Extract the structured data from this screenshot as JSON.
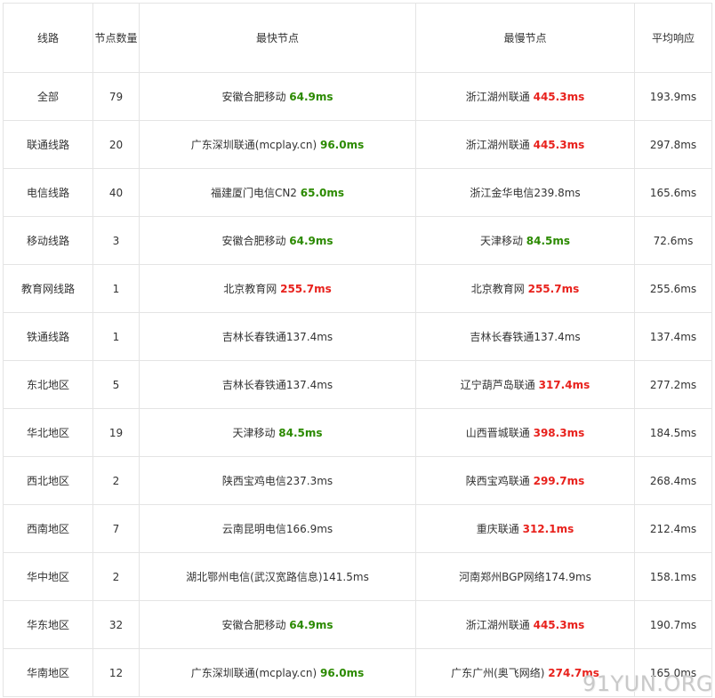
{
  "headers": [
    "线路",
    "节点数量",
    "最快节点",
    "最慢节点",
    "平均响应"
  ],
  "colors": {
    "fast": "#2b8a00",
    "slow": "#e8211c",
    "text": "#333333",
    "border": "#e4e4e4"
  },
  "rows": [
    {
      "line": "全部",
      "count": "79",
      "fast_name": "安徽合肥移动",
      "fast_val": "64.9ms",
      "fast_tone": "fast",
      "slow_name": "浙江湖州联通",
      "slow_val": "445.3ms",
      "slow_tone": "slow",
      "avg": "193.9ms"
    },
    {
      "line": "联通线路",
      "count": "20",
      "fast_name": "广东深圳联通(mcplay.cn)",
      "fast_val": "96.0ms",
      "fast_tone": "fast",
      "slow_name": "浙江湖州联通",
      "slow_val": "445.3ms",
      "slow_tone": "slow",
      "avg": "297.8ms"
    },
    {
      "line": "电信线路",
      "count": "40",
      "fast_name": "福建厦门电信CN2",
      "fast_val": "65.0ms",
      "fast_tone": "fast",
      "slow_name": "浙江金华电信",
      "slow_val": "239.8ms",
      "slow_tone": "plain",
      "avg": "165.6ms"
    },
    {
      "line": "移动线路",
      "count": "3",
      "fast_name": "安徽合肥移动",
      "fast_val": "64.9ms",
      "fast_tone": "fast",
      "slow_name": "天津移动",
      "slow_val": "84.5ms",
      "slow_tone": "fast",
      "avg": "72.6ms"
    },
    {
      "line": "教育网线路",
      "count": "1",
      "fast_name": "北京教育网",
      "fast_val": "255.7ms",
      "fast_tone": "slow",
      "slow_name": "北京教育网",
      "slow_val": "255.7ms",
      "slow_tone": "slow",
      "avg": "255.6ms"
    },
    {
      "line": "铁通线路",
      "count": "1",
      "fast_name": "吉林长春铁通",
      "fast_val": "137.4ms",
      "fast_tone": "plain",
      "slow_name": "吉林长春铁通",
      "slow_val": "137.4ms",
      "slow_tone": "plain",
      "avg": "137.4ms"
    },
    {
      "line": "东北地区",
      "count": "5",
      "fast_name": "吉林长春铁通",
      "fast_val": "137.4ms",
      "fast_tone": "plain",
      "slow_name": "辽宁葫芦岛联通",
      "slow_val": "317.4ms",
      "slow_tone": "slow",
      "avg": "277.2ms"
    },
    {
      "line": "华北地区",
      "count": "19",
      "fast_name": "天津移动",
      "fast_val": "84.5ms",
      "fast_tone": "fast",
      "slow_name": "山西晋城联通",
      "slow_val": "398.3ms",
      "slow_tone": "slow",
      "avg": "184.5ms"
    },
    {
      "line": "西北地区",
      "count": "2",
      "fast_name": "陕西宝鸡电信",
      "fast_val": "237.3ms",
      "fast_tone": "plain",
      "slow_name": "陕西宝鸡联通",
      "slow_val": "299.7ms",
      "slow_tone": "slow",
      "avg": "268.4ms"
    },
    {
      "line": "西南地区",
      "count": "7",
      "fast_name": "云南昆明电信",
      "fast_val": "166.9ms",
      "fast_tone": "plain",
      "slow_name": "重庆联通",
      "slow_val": "312.1ms",
      "slow_tone": "slow",
      "avg": "212.4ms"
    },
    {
      "line": "华中地区",
      "count": "2",
      "fast_name": "湖北鄂州电信(武汉宽路信息)",
      "fast_val": "141.5ms",
      "fast_tone": "plain",
      "slow_name": "河南郑州BGP网络",
      "slow_val": "174.9ms",
      "slow_tone": "plain",
      "avg": "158.1ms"
    },
    {
      "line": "华东地区",
      "count": "32",
      "fast_name": "安徽合肥移动",
      "fast_val": "64.9ms",
      "fast_tone": "fast",
      "slow_name": "浙江湖州联通",
      "slow_val": "445.3ms",
      "slow_tone": "slow",
      "avg": "190.7ms"
    },
    {
      "line": "华南地区",
      "count": "12",
      "fast_name": "广东深圳联通(mcplay.cn)",
      "fast_val": "96.0ms",
      "fast_tone": "fast",
      "slow_name": "广东广州(奥飞网络)",
      "slow_val": "274.7ms",
      "slow_tone": "slow",
      "avg": "165.0ms"
    }
  ],
  "watermark": "91YUN.ORG"
}
